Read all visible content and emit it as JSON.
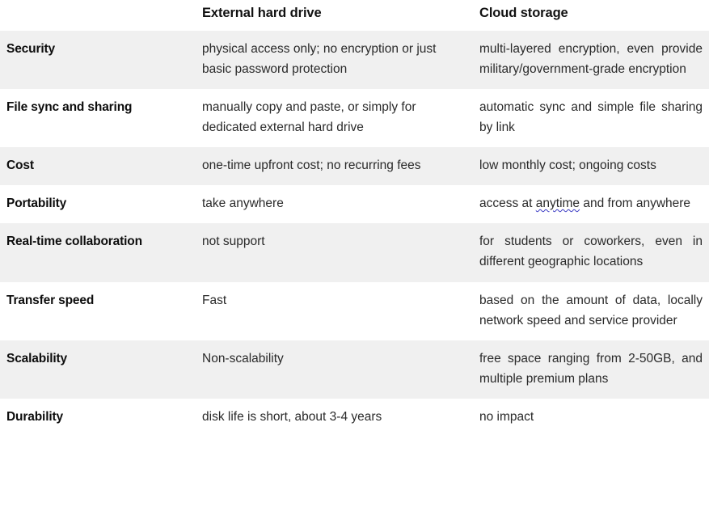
{
  "table": {
    "headers": {
      "feature": "",
      "col1": "External hard drive",
      "col2": "Cloud storage"
    },
    "rows": [
      {
        "feature": "Security",
        "external_hard_drive": "physical access only; no encryption or just basic password protection",
        "cloud_storage": "multi-layered encryption, even provide  military/government-grade encryption"
      },
      {
        "feature": "File sync and sharing",
        "external_hard_drive": "manually copy and paste, or simply for dedicated external hard drive",
        "cloud_storage": "automatic sync and simple file sharing by link"
      },
      {
        "feature": "Cost",
        "external_hard_drive": "one-time upfront cost; no recurring fees",
        "cloud_storage": "low monthly cost; ongoing costs"
      },
      {
        "feature": "Portability",
        "external_hard_drive": "take anywhere",
        "cloud_storage": "access at anytime and from anywhere",
        "cloud_storage_parts": {
          "before": "access at ",
          "misspelled": "anytime",
          "after": " and from anywhere"
        }
      },
      {
        "feature": "Real-time collaboration",
        "external_hard_drive": "not support",
        "cloud_storage": "for students or coworkers, even in different geographic locations"
      },
      {
        "feature": "Transfer speed",
        "external_hard_drive": "Fast",
        "cloud_storage": "based on the amount of data, locally network speed and service provider"
      },
      {
        "feature": "Scalability",
        "external_hard_drive": "Non-scalability",
        "cloud_storage": "free space ranging from 2-50GB, and multiple premium plans"
      },
      {
        "feature": "Durability",
        "external_hard_drive": "disk life is short, about 3-4 years",
        "cloud_storage": "no impact"
      }
    ]
  },
  "style_values": {
    "stripe_color": "#f0f0f0",
    "plain_color": "#ffffff",
    "text_color": "#232323",
    "spellcheck_underline_color": "#3b3bc4"
  }
}
